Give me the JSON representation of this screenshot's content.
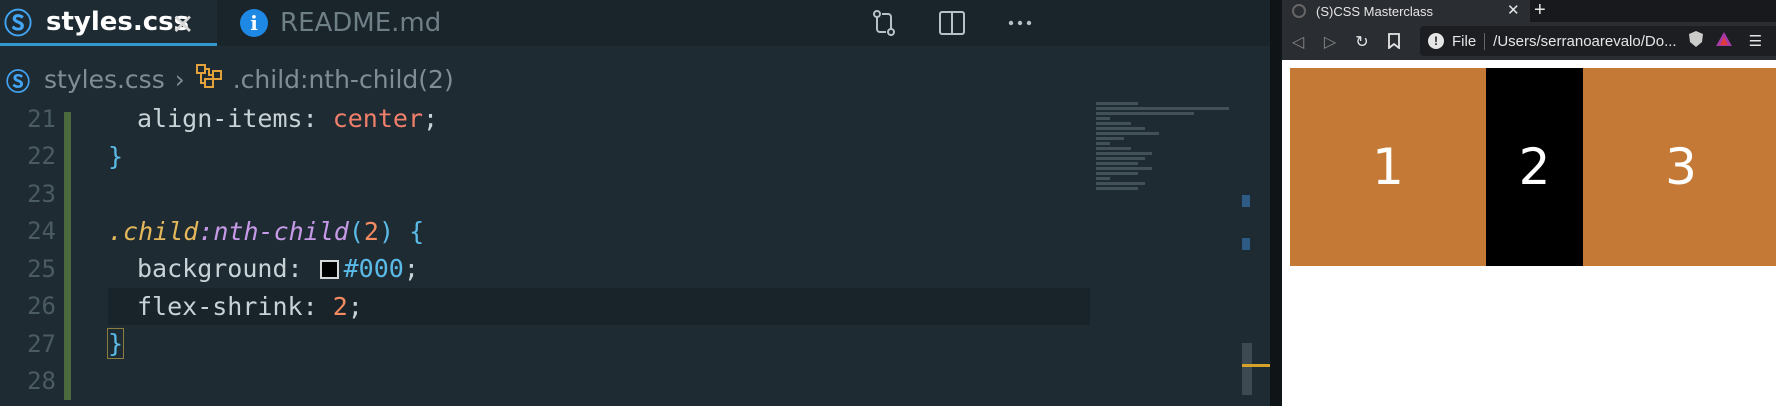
{
  "editor": {
    "tabs": [
      {
        "label": "styles.css",
        "icon": "css3-icon",
        "active": true
      },
      {
        "label": "README.md",
        "icon": "info-icon",
        "active": false
      }
    ],
    "breadcrumb": {
      "file": "styles.css",
      "symbol": ".child:nth-child(2)"
    },
    "lines": [
      {
        "n": "21"
      },
      {
        "n": "22"
      },
      {
        "n": "23"
      },
      {
        "n": "24"
      },
      {
        "n": "25"
      },
      {
        "n": "26"
      },
      {
        "n": "27"
      },
      {
        "n": "28"
      }
    ],
    "code": {
      "l21_prop": "align-items",
      "l21_val": "center",
      "l22_brace": "}",
      "l24_sel": ".child",
      "l24_pseudo": ":nth-child",
      "l24_arg": "2",
      "l24_brace": "{",
      "l25_prop": "background",
      "l25_val": "#000",
      "l26_prop": "flex-shrink",
      "l26_val": "2",
      "l27_brace": "}"
    }
  },
  "browser": {
    "tab_title": "(S)CSS Masterclass",
    "url_scheme": "File",
    "url_path": "/Users/serranoarevalo/Do...",
    "boxes": [
      {
        "label": "1",
        "color": "#c47a36"
      },
      {
        "label": "2",
        "color": "#000000"
      },
      {
        "label": "3",
        "color": "#c47a36"
      }
    ]
  }
}
